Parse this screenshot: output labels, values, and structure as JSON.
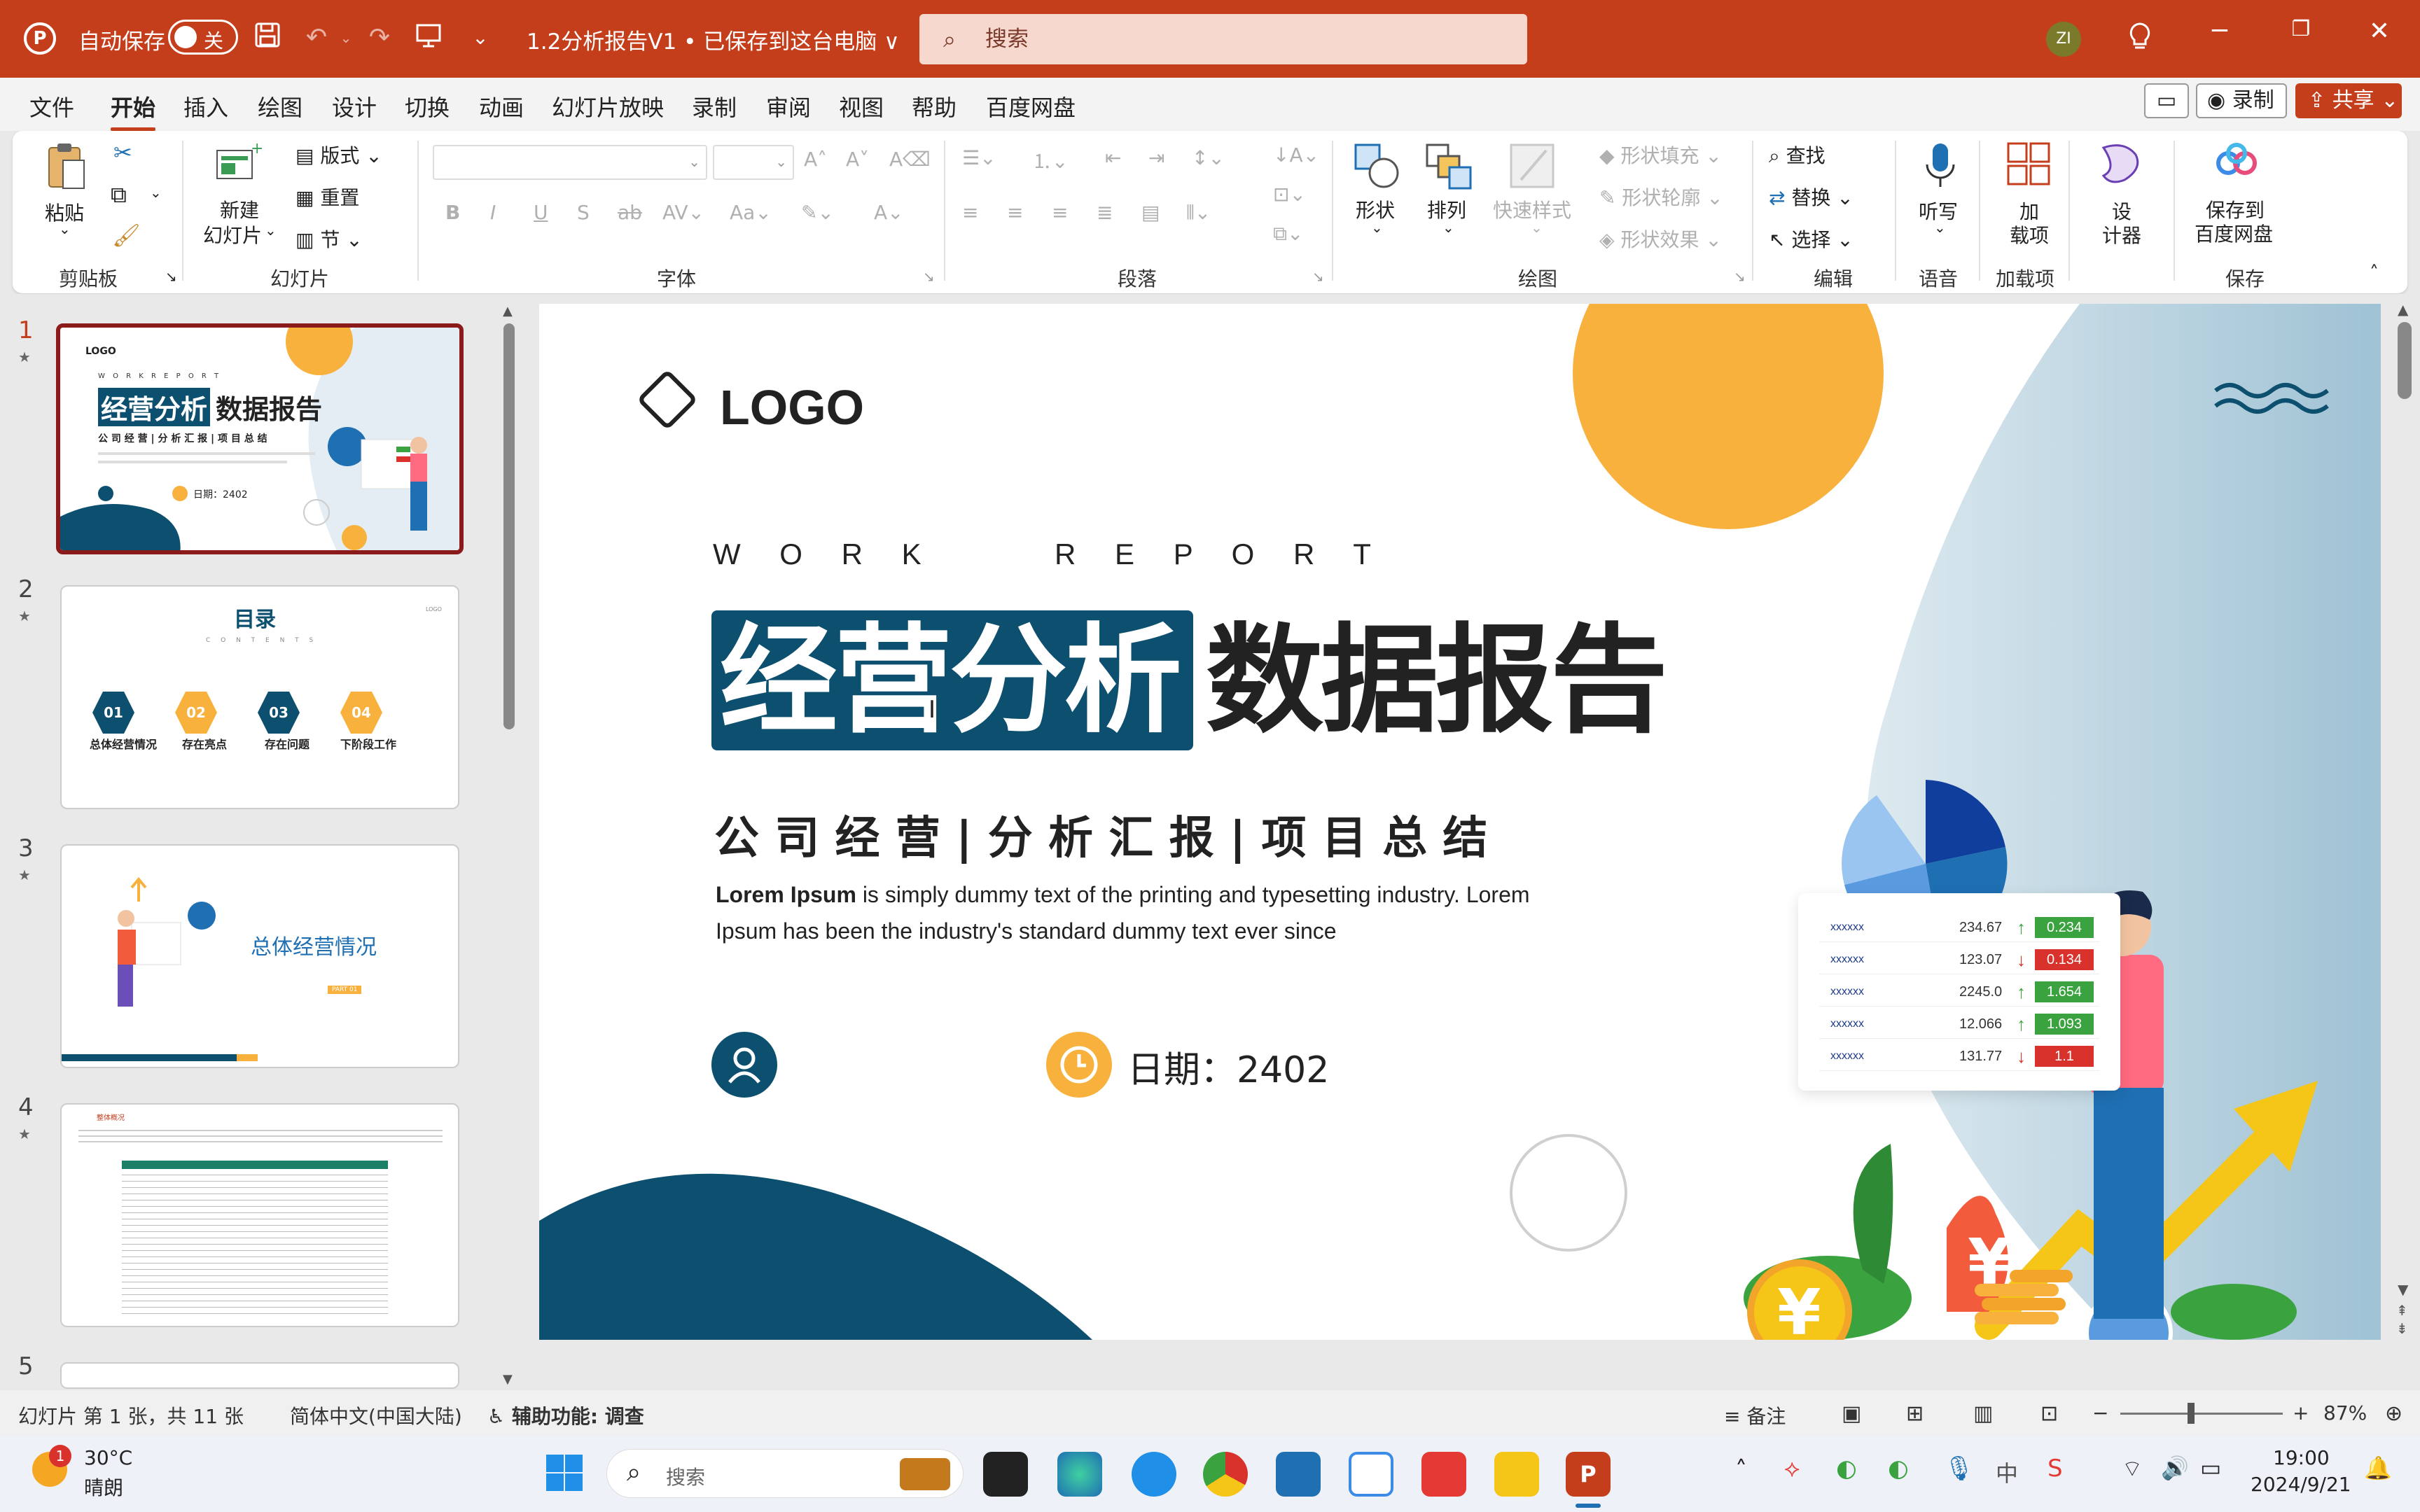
{
  "titlebar": {
    "app_icon": "P",
    "autosave_label": "自动保存",
    "autosave_state": "关",
    "doc_title": "1.2分析报告V1 • 已保存到这台电脑 ∨",
    "search_placeholder": "搜索",
    "user_initials": "ZI"
  },
  "menubar": {
    "tabs": [
      "文件",
      "开始",
      "插入",
      "绘图",
      "设计",
      "切换",
      "动画",
      "幻灯片放映",
      "录制",
      "审阅",
      "视图",
      "帮助",
      "百度网盘"
    ],
    "active_tab": "开始",
    "record_label": "录制",
    "share_label": "共享"
  },
  "ribbon": {
    "clipboard": {
      "label": "剪贴板",
      "paste": "粘贴"
    },
    "slides": {
      "label": "幻灯片",
      "new_slide": "新建",
      "new_slide2": "幻灯片",
      "layout": "版式",
      "reset": "重置",
      "section": "节"
    },
    "font": {
      "label": "字体"
    },
    "paragraph": {
      "label": "段落"
    },
    "drawing": {
      "label": "绘图",
      "shape": "形状",
      "arrange": "排列",
      "quick_styles": "快速样式",
      "shape_fill": "形状填充",
      "shape_outline": "形状轮廓",
      "shape_effects": "形状效果"
    },
    "editing": {
      "label": "编辑",
      "find": "查找",
      "replace": "替换",
      "select": "选择"
    },
    "voice": {
      "label": "语音",
      "dictate": "听写"
    },
    "addins": {
      "label": "加载项",
      "addin1": "加",
      "addin2": "载项"
    },
    "designer": {
      "label1": "设",
      "label2": "计器"
    },
    "save": {
      "label": "保存",
      "save1": "保存到",
      "save2": "百度网盘"
    }
  },
  "thumbnails": [
    {
      "num": "1",
      "title": "经营分析",
      "title2": "数据报告",
      "subtitle": "公 司 经 营 | 分 析 汇 报 | 项 目 总 结",
      "date": "日期：2402",
      "logo": "LOGO",
      "caption": "W O R K   R E P O R T"
    },
    {
      "num": "2",
      "title": "目录",
      "caption": "C O N T E N T S",
      "items": [
        {
          "n": "01",
          "t": "总体经营情况"
        },
        {
          "n": "02",
          "t": "存在亮点"
        },
        {
          "n": "03",
          "t": "存在问题"
        },
        {
          "n": "04",
          "t": "下阶段工作"
        }
      ],
      "logo": "LOGO"
    },
    {
      "num": "3",
      "title": "总体经营情况",
      "badge": "PART 01"
    },
    {
      "num": "4",
      "title": "整体概况"
    },
    {
      "num": "5"
    }
  ],
  "slide": {
    "logo_text": "LOGO",
    "work_report": "W O R K     R E P O R T",
    "title_highlight": "经营分析",
    "title_rest": "数据报告",
    "subtitle": "公 司 经 营 | 分 析 汇 报 | 项 目 总 结",
    "body_bold": "Lorem Ipsum",
    "body_line1": " is simply dummy text of the printing and typesetting industry. Lorem",
    "body_line2": "Ipsum has been the industry's standard dummy text ever since",
    "date_label": "日期：2402",
    "table_rows": [
      {
        "name": "xxxxxx",
        "val": "234.67",
        "dir": "up",
        "chg": "0.234"
      },
      {
        "name": "xxxxxx",
        "val": "123.07",
        "dir": "down",
        "chg": "0.134"
      },
      {
        "name": "xxxxxx",
        "val": "2245.0",
        "dir": "up",
        "chg": "1.654"
      },
      {
        "name": "xxxxxx",
        "val": "12.066",
        "dir": "up",
        "chg": "1.093"
      },
      {
        "name": "xxxxxx",
        "val": "131.77",
        "dir": "down",
        "chg": "1.1"
      }
    ],
    "colors": {
      "navy": "#0c4f6e",
      "orange": "#f9b13e",
      "green": "#3aa33f",
      "red": "#d9312b"
    }
  },
  "statusbar": {
    "slide_info": "幻灯片 第 1 张，共 11 张",
    "language": "简体中文(中国大陆)",
    "accessibility": "辅助功能: 调查",
    "notes": "备注",
    "zoom": "87%"
  },
  "taskbar": {
    "weather_temp": "30°C",
    "weather_desc": "晴朗",
    "weather_badge": "1",
    "search": "搜索",
    "time": "19:00",
    "date": "2024/9/21",
    "ime": "中"
  }
}
